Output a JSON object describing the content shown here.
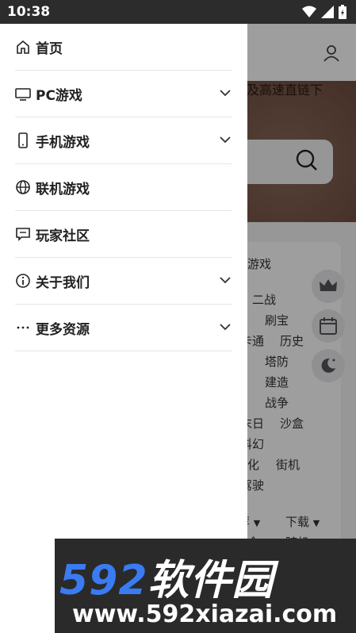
{
  "status_bar": {
    "time": "10:38"
  },
  "background": {
    "banner_title": "以及高速直链下",
    "category_title": "游戏",
    "categories": [
      {
        "text": "二战"
      },
      {
        "text": "刷宝"
      },
      {
        "text": "卡通"
      },
      {
        "text": "历史"
      },
      {
        "text": "塔防"
      },
      {
        "text": "建造"
      },
      {
        "text": "战争"
      },
      {
        "text": "末日"
      },
      {
        "text": "沙盒"
      },
      {
        "text": "科幻"
      },
      {
        "text": "化"
      },
      {
        "text": "街机"
      },
      {
        "text": "驾驶"
      }
    ],
    "sort_labels": [
      "荐",
      "下载"
    ],
    "bottom_partial": [
      "全",
      "随机"
    ]
  },
  "drawer": {
    "items": [
      {
        "label": "首页",
        "icon": "home-icon",
        "expandable": false
      },
      {
        "label": "PC游戏",
        "icon": "monitor-icon",
        "expandable": true
      },
      {
        "label": "手机游戏",
        "icon": "phone-icon",
        "expandable": true
      },
      {
        "label": "联机游戏",
        "icon": "globe-icon",
        "expandable": false
      },
      {
        "label": "玩家社区",
        "icon": "chat-icon",
        "expandable": false
      },
      {
        "label": "关于我们",
        "icon": "info-icon",
        "expandable": true
      },
      {
        "label": "更多资源",
        "icon": "more-icon",
        "expandable": true
      }
    ]
  },
  "watermark": {
    "number": "592",
    "brand": "软件园",
    "url": "www.592xiazai.com"
  }
}
